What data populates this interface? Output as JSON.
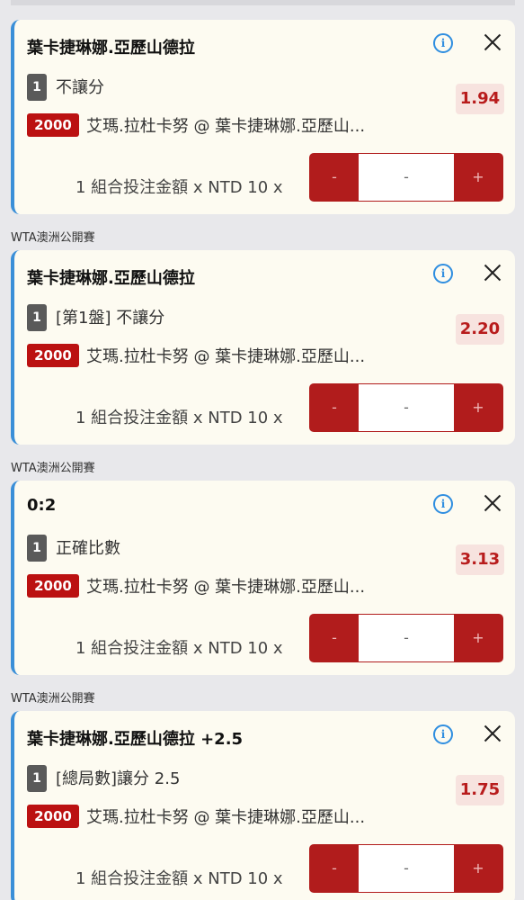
{
  "bets": [
    {
      "league": "",
      "title": "葉卡捷琳娜.亞歷山德拉",
      "bet_count": "1",
      "bet_type": "不讓分",
      "odds": "1.94",
      "match_id": "2000",
      "match": "艾瑪.拉杜卡努 @ 葉卡捷琳娜.亞歷山...",
      "stake_label": "1 組合投注金額 x NTD 10 x",
      "stepper": {
        "minus": "-",
        "value": "-",
        "plus": "+"
      }
    },
    {
      "league": "WTA澳洲公開賽",
      "title": "葉卡捷琳娜.亞歷山德拉",
      "bet_count": "1",
      "bet_type": "[第1盤] 不讓分",
      "odds": "2.20",
      "match_id": "2000",
      "match": "艾瑪.拉杜卡努 @ 葉卡捷琳娜.亞歷山...",
      "stake_label": "1 組合投注金額 x NTD 10 x",
      "stepper": {
        "minus": "-",
        "value": "-",
        "plus": "+"
      }
    },
    {
      "league": "WTA澳洲公開賽",
      "title": "0:2",
      "bet_count": "1",
      "bet_type": "正確比數",
      "odds": "3.13",
      "match_id": "2000",
      "match": "艾瑪.拉杜卡努 @ 葉卡捷琳娜.亞歷山...",
      "stake_label": "1 組合投注金額 x NTD 10 x",
      "stepper": {
        "minus": "-",
        "value": "-",
        "plus": "+"
      }
    },
    {
      "league": "WTA澳洲公開賽",
      "title": "葉卡捷琳娜.亞歷山德拉 +2.5",
      "bet_count": "1",
      "bet_type": "[總局數]讓分 2.5",
      "odds": "1.75",
      "match_id": "2000",
      "match": "艾瑪.拉杜卡努 @ 葉卡捷琳娜.亞歷山...",
      "stake_label": "1 組合投注金額 x NTD 10 x",
      "stepper": {
        "minus": "-",
        "value": "-",
        "plus": "+"
      }
    }
  ],
  "icons": {
    "info": "info-icon",
    "close": "close-icon"
  },
  "colors": {
    "accent_blue": "#3a8fd8",
    "odds_red": "#b81c1c",
    "stepper_red": "#b11c1c",
    "id_badge_red": "#bb1111",
    "card_bg": "#fdfbf1",
    "page_bg": "#e8e8eb"
  }
}
